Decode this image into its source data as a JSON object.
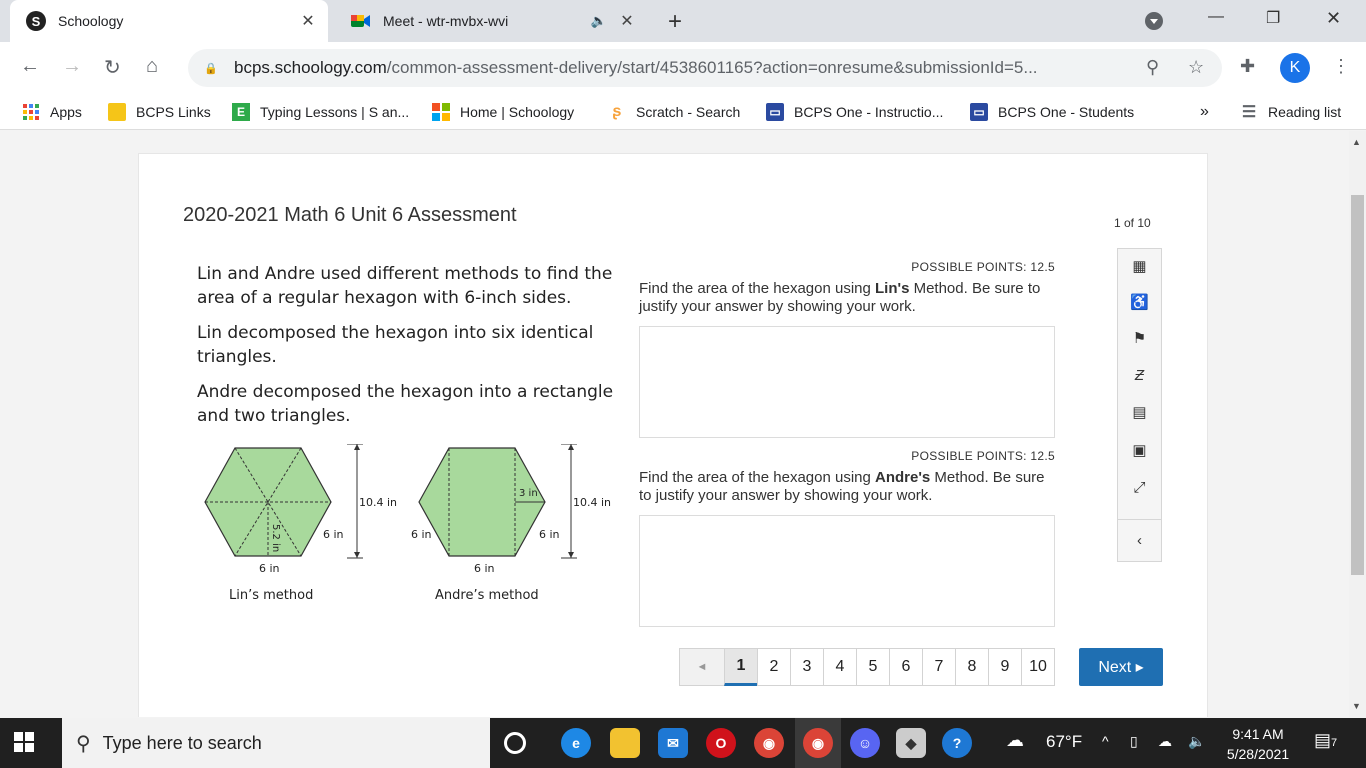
{
  "browser": {
    "tabs": [
      {
        "title": "Schoology",
        "favicon": "S"
      },
      {
        "title": "Meet - wtr-mvbx-wvi"
      }
    ],
    "url_domain": "bcps.schoology.com",
    "url_path": "/common-assessment-delivery/start/4538601165?action=onresume&submissionId=5...",
    "profile_initial": "K",
    "bookmarks": [
      "Apps",
      "BCPS Links",
      "Typing Lessons | S an...",
      "Home | Schoology",
      "Scratch - Search",
      "BCPS One - Instructio...",
      "BCPS One - Students"
    ],
    "reading_list": "Reading list",
    "overflow": "»"
  },
  "assessment": {
    "title": "2020-2021 Math 6 Unit 6 Assessment",
    "page_count": "1 of 10",
    "stem": [
      "Lin and Andre used different methods to find the area of a regular hexagon with 6-inch sides.",
      "Lin decomposed the hexagon into six identical triangles.",
      "Andre decomposed the hexagon into a rectangle and two triangles."
    ],
    "figure": {
      "lin_caption": "Lin’s method",
      "andre_caption": "Andre’s method",
      "labels": {
        "height": "10.4 in",
        "side": "6 in",
        "apothem": "5.2 in",
        "tri_height": "3 in"
      }
    },
    "questions": [
      {
        "points": "POSSIBLE POINTS: 12.5",
        "prompt_pre": "Find the area of the hexagon using ",
        "prompt_bold": "Lin's",
        "prompt_post": " Method. Be sure to justify your answer by showing your work."
      },
      {
        "points": "POSSIBLE POINTS: 12.5",
        "prompt_pre": "Find the area of the hexagon using ",
        "prompt_bold": "Andre's",
        "prompt_post": " Method. Be sure to justify your answer by showing your work."
      }
    ],
    "pager": {
      "prev": "◄",
      "pages": [
        "1",
        "2",
        "3",
        "4",
        "5",
        "6",
        "7",
        "8",
        "9",
        "10"
      ],
      "current": "1",
      "next": "Next ▸"
    }
  },
  "taskbar": {
    "search_placeholder": "Type here to search",
    "weather": "67°F",
    "time": "9:41 AM",
    "date": "5/28/2021",
    "notifications": "7"
  }
}
